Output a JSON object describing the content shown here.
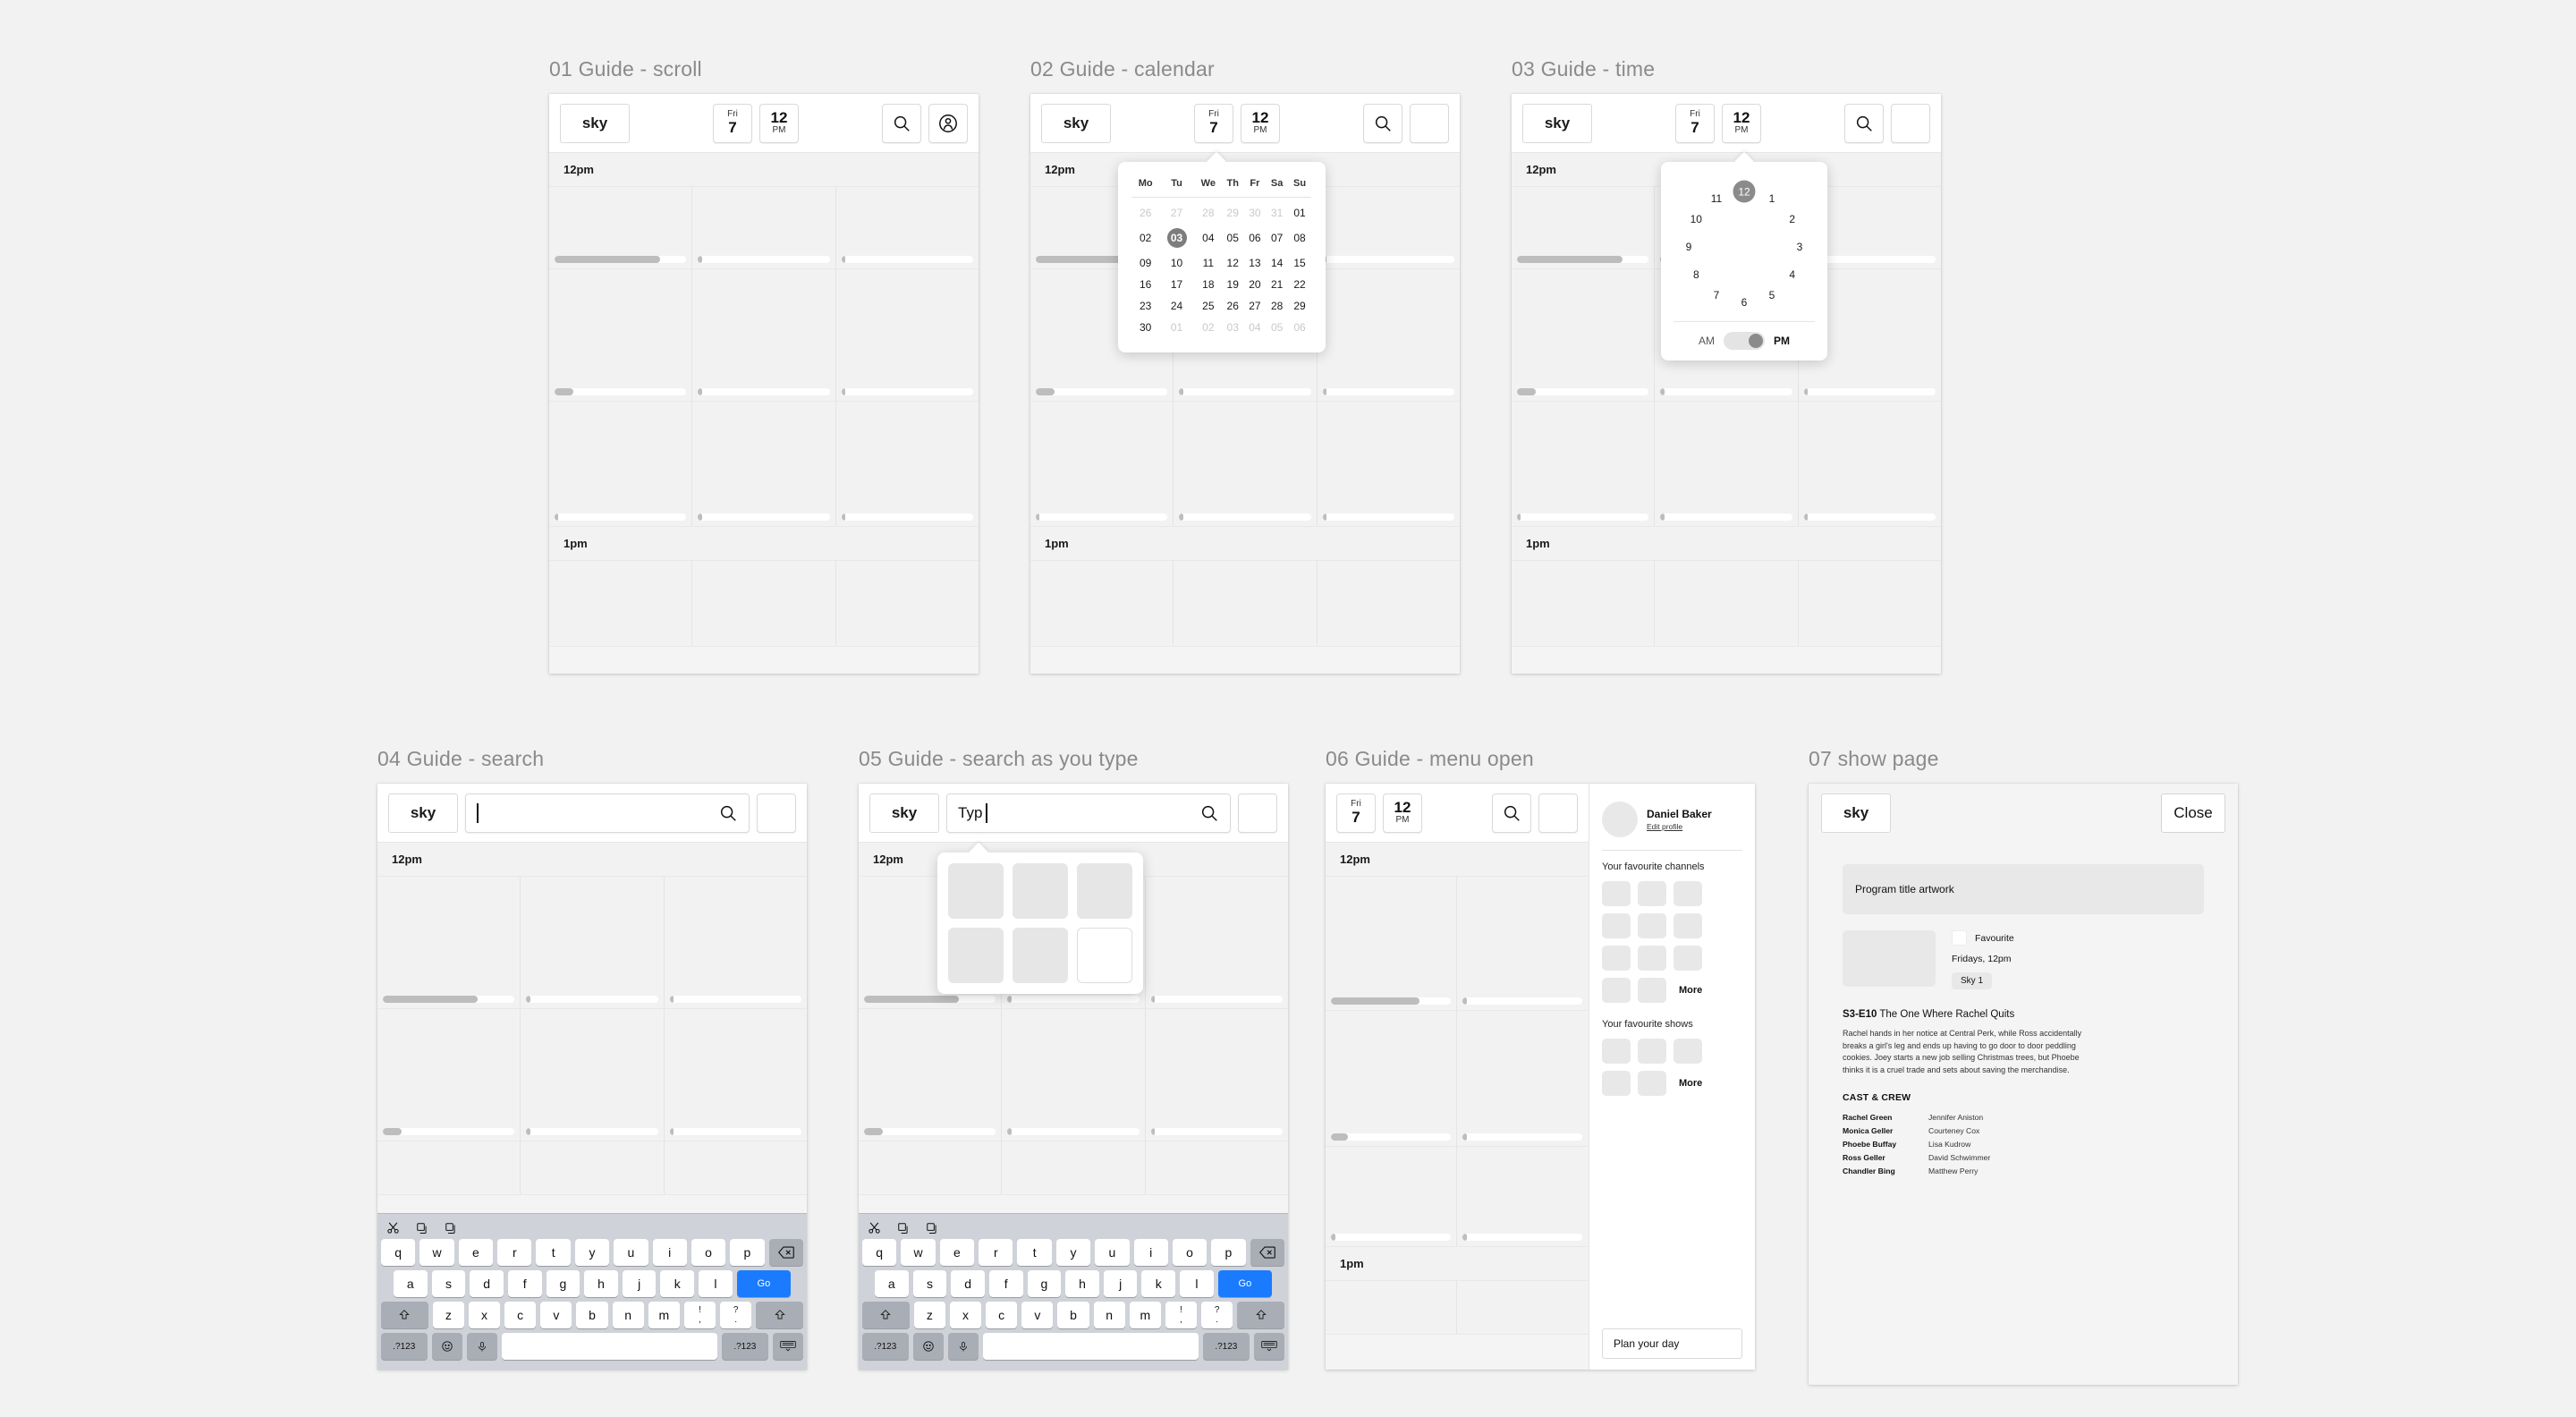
{
  "frames": [
    {
      "title": "01 Guide - scroll"
    },
    {
      "title": "02 Guide - calendar"
    },
    {
      "title": "03 Guide - time"
    },
    {
      "title": "04 Guide - search"
    },
    {
      "title": "05 Guide - search as you type"
    },
    {
      "title": "06 Guide - menu open"
    },
    {
      "title": "07 show page"
    }
  ],
  "appbar": {
    "logo": "sky",
    "date_dow": "Fri",
    "date_num": "7",
    "time_hour": "12",
    "time_meridiem": "PM",
    "search_icon": "search-icon",
    "profile_icon": "profile-avatar-icon"
  },
  "guide": {
    "hour_top": "12pm",
    "hour_next": "1pm"
  },
  "calendar": {
    "weekdays": [
      "Mo",
      "Tu",
      "We",
      "Th",
      "Fr",
      "Sa",
      "Su"
    ],
    "weeks": [
      [
        {
          "d": "26",
          "m": true
        },
        {
          "d": "27",
          "m": true
        },
        {
          "d": "28",
          "m": true
        },
        {
          "d": "29",
          "m": true
        },
        {
          "d": "30",
          "m": true
        },
        {
          "d": "31",
          "m": true
        },
        {
          "d": "01",
          "m": false
        }
      ],
      [
        {
          "d": "02",
          "m": false
        },
        {
          "d": "03",
          "m": false,
          "sel": true
        },
        {
          "d": "04",
          "m": false
        },
        {
          "d": "05",
          "m": false
        },
        {
          "d": "06",
          "m": false
        },
        {
          "d": "07",
          "m": false
        },
        {
          "d": "08",
          "m": false
        }
      ],
      [
        {
          "d": "09",
          "m": false
        },
        {
          "d": "10",
          "m": false
        },
        {
          "d": "11",
          "m": false
        },
        {
          "d": "12",
          "m": false
        },
        {
          "d": "13",
          "m": false
        },
        {
          "d": "14",
          "m": false
        },
        {
          "d": "15",
          "m": false
        }
      ],
      [
        {
          "d": "16",
          "m": false
        },
        {
          "d": "17",
          "m": false
        },
        {
          "d": "18",
          "m": false
        },
        {
          "d": "19",
          "m": false
        },
        {
          "d": "20",
          "m": false
        },
        {
          "d": "21",
          "m": false
        },
        {
          "d": "22",
          "m": false
        }
      ],
      [
        {
          "d": "23",
          "m": false
        },
        {
          "d": "24",
          "m": false
        },
        {
          "d": "25",
          "m": false
        },
        {
          "d": "26",
          "m": false
        },
        {
          "d": "27",
          "m": false
        },
        {
          "d": "28",
          "m": false
        },
        {
          "d": "29",
          "m": false
        }
      ],
      [
        {
          "d": "30",
          "m": false
        },
        {
          "d": "01",
          "m": true
        },
        {
          "d": "02",
          "m": true
        },
        {
          "d": "03",
          "m": true
        },
        {
          "d": "04",
          "m": true
        },
        {
          "d": "05",
          "m": true
        },
        {
          "d": "06",
          "m": true
        }
      ]
    ],
    "selected": "03"
  },
  "clock": {
    "hours": [
      "12",
      "1",
      "2",
      "3",
      "4",
      "5",
      "6",
      "7",
      "8",
      "9",
      "10",
      "11"
    ],
    "selected": "12",
    "am_label": "AM",
    "pm_label": "PM",
    "meridiem_selected": "PM"
  },
  "search": {
    "empty_value": "",
    "typed_value": "Typ"
  },
  "keyboard": {
    "toolbar_icons": [
      "cut-icon",
      "copy-icon",
      "paste-icon"
    ],
    "row1": [
      "q",
      "w",
      "e",
      "r",
      "t",
      "y",
      "u",
      "i",
      "o",
      "p"
    ],
    "backspace": "backspace-icon",
    "row2": [
      "a",
      "s",
      "d",
      "f",
      "g",
      "h",
      "j",
      "k",
      "l"
    ],
    "go_label": "Go",
    "shift": "shift-icon",
    "row3": [
      "z",
      "x",
      "c",
      "v",
      "b",
      "n",
      "m"
    ],
    "punct1_top": "!",
    "punct1_bottom": ",",
    "punct2_top": "?",
    "punct2_bottom": ".",
    "numeric_label": ".?123",
    "emoji": "emoji-icon",
    "mic": "microphone-icon",
    "space": "",
    "dismiss": "hide-keyboard-icon"
  },
  "menu": {
    "profile_name": "Daniel Baker",
    "edit_profile": "Edit profile",
    "channels_label": "Your favourite channels",
    "channels_more": "More",
    "shows_label": "Your favourite shows",
    "shows_more": "More",
    "plan_button": "Plan your day"
  },
  "showpage": {
    "logo": "sky",
    "close_label": "Close",
    "artwork_label": "Program title artwork",
    "favourite_label": "Favourite",
    "airtime": "Fridays, 12pm",
    "channel": "Sky 1",
    "episode_code": "S3-E10",
    "episode_name": "The One Where Rachel Quits",
    "description": "Rachel hands in her notice at Central Perk, while Ross accidentally breaks a girl's leg and ends up having to go door to door peddling cookies. Joey starts a new job selling Christmas trees, but Phoebe thinks it is a cruel trade and sets about saving the merchandise.",
    "cast_heading": "CAST & CREW",
    "cast": [
      {
        "character": "Rachel Green",
        "actor": "Jennifer Aniston"
      },
      {
        "character": "Monica Geller",
        "actor": "Courteney Cox"
      },
      {
        "character": "Phoebe Buffay",
        "actor": "Lisa Kudrow"
      },
      {
        "character": "Ross Geller",
        "actor": "David Schwimmer"
      },
      {
        "character": "Chandler Bing",
        "actor": "Matthew Perry"
      }
    ]
  },
  "colors": {
    "canvas": "#f2f2f2",
    "accent_blue": "#1a7bff",
    "selection_grey": "#7d7d7d",
    "placeholder_grey": "#e6e6e6"
  }
}
